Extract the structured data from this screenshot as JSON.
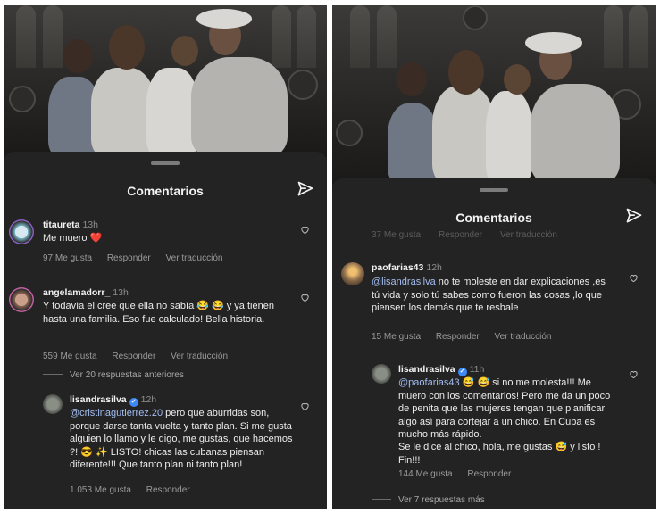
{
  "left": {
    "sheet_title": "Comentarios",
    "comments": [
      {
        "username": "titaureta",
        "time": "13h",
        "verified": false,
        "text": "Me muero ❤️",
        "likes": "97 Me gusta",
        "reply": "Responder",
        "translate": "Ver traducción"
      },
      {
        "username": "angelamadorr_",
        "time": "13h",
        "verified": false,
        "text": "Y todavía el cree que ella no sabía 😂 😂 y ya tienen hasta una familia. Eso fue calculado! Bella historia.",
        "likes": "559 Me gusta",
        "reply": "Responder",
        "translate": "Ver traducción"
      }
    ],
    "view_previous": "Ver 20 respuestas anteriores",
    "reply": {
      "username": "lisandrasilva",
      "time": "12h",
      "verified": true,
      "mention": "@cristinagutierrez.20",
      "text": " pero que aburridas son, porque darse tanta vuelta y tanto plan. Si me gusta alguien lo llamo y le digo, me gustas, que hacemos ?! 😎 ✨ LISTO! chicas las cubanas piensan diferente!!! Que tanto plan ni tanto plan!",
      "likes": "1.053 Me gusta",
      "reply": "Responder"
    }
  },
  "right": {
    "sheet_title": "Comentarios",
    "ghost_row": {
      "likes": "37 Me gusta",
      "reply": "Responder",
      "translate": "Ver traducción"
    },
    "comment": {
      "username": "paofarias43",
      "time": "12h",
      "verified": false,
      "mention": "@lisandrasilva",
      "text": " no te moleste en dar explicaciones ,es tú vida y solo tú sabes como fueron las cosas ,lo que piensen los demás que te resbale",
      "likes": "15 Me gusta",
      "reply": "Responder",
      "translate": "Ver traducción"
    },
    "reply": {
      "username": "lisandrasilva",
      "time": "11h",
      "verified": true,
      "mention": "@paofarias43",
      "text": " 😅 😅 si no me molesta!!! Me muero con los comentarios! Pero me da un poco de penita que las mujeres tengan que planificar algo así para cortejar a un chico. En Cuba es mucho más rápido.",
      "text2": "Se le dice al chico, hola, me gustas 😅 y listo ! Fin!!!",
      "likes": "144 Me gusta",
      "reply": "Responder"
    },
    "view_more": "Ver 7 respuestas más"
  },
  "icons": {
    "send": "send-paper-plane-icon",
    "heart": "heart-outline-icon",
    "verified": "verified-badge-icon"
  },
  "colors": {
    "sheet_bg": "#232323",
    "mention": "#a3bdf3",
    "verified": "#3d8af7",
    "heart_emoji": "#e0245e"
  }
}
